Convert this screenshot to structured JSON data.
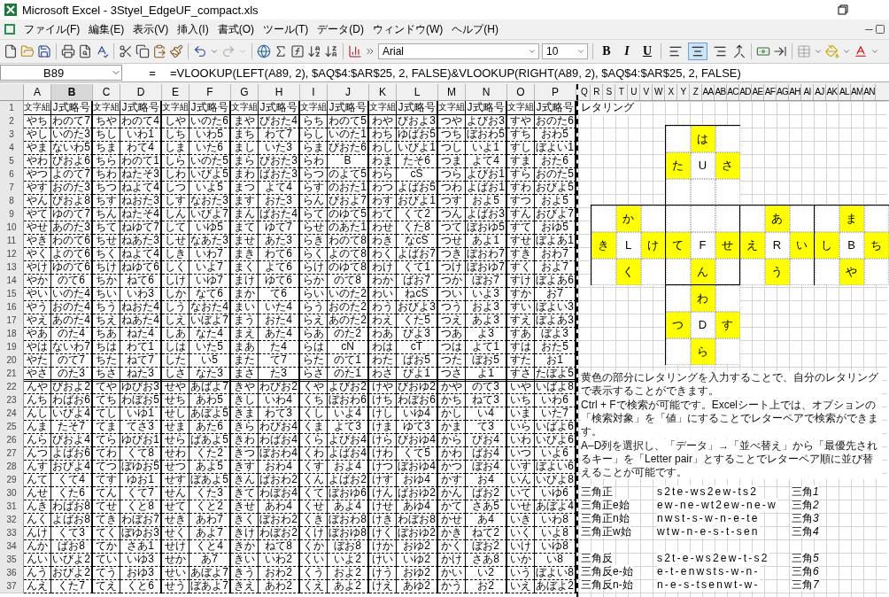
{
  "window": {
    "title": "Microsoft Excel - 3Styel_EdgeUF_compact.xls"
  },
  "menu": [
    "ファイル(F)",
    "編集(E)",
    "表示(V)",
    "挿入(I)",
    "書式(O)",
    "ツール(T)",
    "データ(D)",
    "ウィンドウ(W)",
    "ヘルプ(H)"
  ],
  "toolbar": {
    "font_name": "Arial",
    "font_size": "10",
    "style_buttons": [
      "B",
      "I",
      "U"
    ],
    "alignment": [
      {
        "selected": false
      },
      {
        "selected": true
      },
      {
        "selected": false
      }
    ]
  },
  "formula_bar": {
    "name_box": "B89",
    "equals": "=",
    "formula": "=VLOOKUP(LEFT(A89, 2), $AQ$4:$AR$25, 2, FALSE)&VLOOKUP(RIGHT(A89, 2), $AQ$4:$AR$25, 2, FALSE)"
  },
  "sheet": {
    "columns": [
      {
        "label": "A",
        "selected": false
      },
      {
        "label": "B",
        "selected": true
      },
      {
        "label": "C",
        "selected": false
      },
      {
        "label": "D",
        "selected": false
      },
      {
        "label": "E",
        "selected": false
      },
      {
        "label": "F",
        "selected": false
      },
      {
        "label": "G",
        "selected": false
      },
      {
        "label": "H",
        "selected": false
      },
      {
        "label": "I",
        "selected": false
      },
      {
        "label": "J",
        "selected": false
      },
      {
        "label": "K",
        "selected": false
      },
      {
        "label": "L",
        "selected": false
      },
      {
        "label": "M",
        "selected": false
      },
      {
        "label": "N",
        "selected": false
      },
      {
        "label": "O",
        "selected": false
      },
      {
        "label": "P",
        "selected": false
      }
    ],
    "panel_columns": [
      "Q",
      "R",
      "S",
      "T",
      "U",
      "V",
      "W",
      "X",
      "Y",
      "Z",
      "AA",
      "AB",
      "AC",
      "AD",
      "AE",
      "AF",
      "AG",
      "AH",
      "AI",
      "AJ",
      "AK",
      "AL",
      "AM",
      "AN"
    ],
    "header_row": {
      "number": "1",
      "cells": [
        "文字組",
        "J式略号",
        "文字組",
        "J式略号",
        "文字組",
        "J式略号",
        "文字組",
        "J式略号",
        "文字組",
        "J式略号",
        "文字組",
        "J式略号",
        "文字組",
        "J式略号",
        "文字組",
        "J式略号"
      ]
    },
    "blocks": [
      {
        "rows": [
          {
            "number": "2",
            "cells": [
              "やち",
              "わのて7",
              "ちや",
              "わのて4",
              "しや",
              "いのた6",
              "まや",
              "びおた4",
              "らち",
              "わのて5",
              "わや",
              "びおよ3",
              "つや",
              "よびお3",
              "すや",
              "おのた6"
            ]
          },
          {
            "number": "3",
            "cells": [
              "やし",
              "いのた3",
              "ちし",
              "いわ1",
              "しち",
              "いわ5",
              "まち",
              "わて7",
              "らし",
              "いのた1",
              "わち",
              "ゆばお5",
              "つち",
              "ぼおわ5",
              "すち",
              "おわ5"
            ]
          },
          {
            "number": "4",
            "cells": [
              "やま",
              "ないわ5",
              "ちま",
              "わて4",
              "しま",
              "いた6",
              "まし",
              "いた3",
              "らま",
              "びおた6",
              "わし",
              "いびよ1",
              "つし",
              "いよ1",
              "すし",
              "ぼよい1"
            ]
          },
          {
            "number": "5",
            "cells": [
              "やわ",
              "びおよ6",
              "ちら",
              "わのて1",
              "しら",
              "いのた5",
              "まら",
              "びおた3",
              "らわ",
              "B",
              "わま",
              "たそ6",
              "つま",
              "よて4",
              "すま",
              "おた6"
            ]
          },
          {
            "number": "6",
            "cells": [
              "やつ",
              "よのて7",
              "ちわ",
              "ねたそ3",
              "しわ",
              "いびよ5",
              "まわ",
              "ばおた3",
              "らつ",
              "のよて5",
              "わら",
              "cS",
              "つら",
              "よびお1",
              "すら",
              "おのた5"
            ]
          },
          {
            "number": "7",
            "cells": [
              "やす",
              "おのた3",
              "ちつ",
              "ねよて4",
              "しつ",
              "いよ5",
              "まつ",
              "よて4",
              "らす",
              "のおた1",
              "わつ",
              "よばお5",
              "つわ",
              "よばお1",
              "すわ",
              "おびよ5"
            ]
          },
          {
            "number": "8",
            "cells": [
              "やん",
              "びおよ8",
              "ちす",
              "ねおた3",
              "しす",
              "なおた3",
              "ます",
              "おた3",
              "らん",
              "びおよ7",
              "わす",
              "おびよ1",
              "つす",
              "およ5",
              "すつ",
              "およ5"
            ]
          },
          {
            "number": "9",
            "cells": [
              "やて",
              "ゆのて7",
              "ちん",
              "ねたそ4",
              "しん",
              "いびよ7",
              "まん",
              "ばおた4",
              "らて",
              "のゆて5",
              "わて",
              "くて2",
              "つん",
              "よばお3",
              "すん",
              "おびよ7"
            ]
          },
          {
            "number": "10",
            "cells": [
              "やせ",
              "あのた3",
              "ちて",
              "ねゆて7",
              "して",
              "いゆ5",
              "まて",
              "ゆて7",
              "らせ",
              "のあた1",
              "わせ",
              "くた8",
              "つて",
              "ぼおゆ5",
              "すて",
              "おゆ5"
            ]
          },
          {
            "number": "11",
            "cells": [
              "やき",
              "わのて6",
              "ちせ",
              "ねあた3",
              "しせ",
              "なあた3",
              "ませ",
              "あた3",
              "らき",
              "わのて8",
              "わき",
              "なcS",
              "つせ",
              "あよ1",
              "すせ",
              "ぼよあ1"
            ]
          },
          {
            "number": "12",
            "cells": [
              "やく",
              "よのて6",
              "ちく",
              "ねよて4",
              "しき",
              "いわ7",
              "まき",
              "わて6",
              "らく",
              "よのて8",
              "わく",
              "よばお7",
              "つき",
              "ぼおわ7",
              "すき",
              "おわ7"
            ]
          },
          {
            "number": "13",
            "cells": [
              "やけ",
              "ゆのて6",
              "ちけ",
              "ねゆて6",
              "しく",
              "いよ7",
              "まく",
              "よて6",
              "らけ",
              "のゆて8",
              "わけ",
              "くて1",
              "つけ",
              "ぼおゆ7",
              "すく",
              "およ7"
            ]
          },
          {
            "number": "14",
            "cells": [
              "やか",
              "のて6",
              "ちか",
              "ねて6",
              "しけ",
              "いゆ7",
              "まけ",
              "ゆて6",
              "らか",
              "のて8",
              "わか",
              "ばお7",
              "つか",
              "ぼお7",
              "すけ",
              "ぼよあ6"
            ]
          },
          {
            "number": "15",
            "cells": [
              "やい",
              "いのた4",
              "ちい",
              "いわ3",
              "しか",
              "なて6",
              "まか",
              "て6",
              "らい",
              "いのた2",
              "わい",
              "ねcS",
              "つい",
              "いよ3",
              "すか",
              "お7"
            ]
          },
          {
            "number": "16",
            "cells": [
              "やう",
              "おのた4",
              "ちう",
              "ねおた4",
              "しう",
              "なおた4",
              "まい",
              "いた4",
              "らう",
              "おのた2",
              "わう",
              "おびよ3",
              "つう",
              "およ3",
              "すい",
              "ぼよい3"
            ]
          },
          {
            "number": "17",
            "cells": [
              "やえ",
              "あのた4",
              "ちえ",
              "ねあた4",
              "しえ",
              "いぼよ7",
              "まう",
              "おた4",
              "らえ",
              "あのた2",
              "わえ",
              "くた5",
              "つえ",
              "あよ3",
              "すえ",
              "ぼよあ3"
            ]
          },
          {
            "number": "18",
            "cells": [
              "やあ",
              "のた4",
              "ちあ",
              "ねた4",
              "しあ",
              "なた4",
              "まえ",
              "あた4",
              "らあ",
              "のた2",
              "わあ",
              "びよ3",
              "つあ",
              "よ3",
              "すあ",
              "ぼよ3"
            ]
          },
          {
            "number": "19",
            "cells": [
              "やは",
              "ないわ7",
              "ちは",
              "わて1",
              "しは",
              "いた5",
              "まあ",
              "た4",
              "らは",
              "cN",
              "わは",
              "cT",
              "つは",
              "よて1",
              "すは",
              "おた5"
            ]
          },
          {
            "number": "20",
            "cells": [
              "やた",
              "のて7",
              "ちた",
              "ねて7",
              "した",
              "い5",
              "また",
              "て7",
              "らた",
              "のて1",
              "わた",
              "ばお5",
              "つた",
              "ぼお5",
              "すた",
              "お1"
            ]
          },
          {
            "number": "21",
            "cells": [
              "やさ",
              "のた3",
              "ちさ",
              "ねた3",
              "しさ",
              "なた3",
              "まさ",
              "た3",
              "らさ",
              "のた1",
              "わさ",
              "びよ1",
              "つさ",
              "よ1",
              "すさ",
              "たぼよ5"
            ]
          }
        ]
      },
      {
        "rows": [
          {
            "number": "22",
            "cells": [
              "んや",
              "びおよ2",
              "てや",
              "ゆびお3",
              "せや",
              "あばよ7",
              "きや",
              "わびお2",
              "くや",
              "よびお2",
              "けや",
              "びおゆ2",
              "かや",
              "のて3",
              "いや",
              "いばよ8"
            ]
          },
          {
            "number": "23",
            "cells": [
              "んち",
              "わばお6",
              "てち",
              "わぼお5",
              "せち",
              "あわ5",
              "きし",
              "いわ4",
              "くち",
              "ぼおわ6",
              "けち",
              "わぼお6",
              "かち",
              "ねて3",
              "いち",
              "いわ6"
            ]
          },
          {
            "number": "24",
            "cells": [
              "んし",
              "いびよ4",
              "てし",
              "いゆ1",
              "せし",
              "あぼよ5",
              "きま",
              "わて3",
              "くし",
              "いよ4",
              "けし",
              "いゆ4",
              "かし",
              "い4",
              "いま",
              "いた7"
            ]
          },
          {
            "number": "25",
            "cells": [
              "んま",
              "たそ7",
              "てま",
              "てさ3",
              "せま",
              "あた6",
              "きら",
              "わびお4",
              "くま",
              "よて3",
              "けま",
              "ゆて3",
              "かま",
              "て3",
              "いら",
              "いばよ6"
            ]
          },
          {
            "number": "26",
            "cells": [
              "んら",
              "びおよ4",
              "てら",
              "ゆびお1",
              "せら",
              "ばあよ5",
              "きわ",
              "わばお4",
              "くら",
              "よびお4",
              "けら",
              "びおゆ4",
              "から",
              "びお4",
              "いわ",
              "いびよ6"
            ]
          },
          {
            "number": "27",
            "cells": [
              "んつ",
              "よばお6",
              "てわ",
              "くて8",
              "せわ",
              "くた2",
              "きつ",
              "ぼおわ4",
              "くわ",
              "よばお4",
              "けわ",
              "くて5",
              "かわ",
              "ばお4",
              "いつ",
              "いよ6"
            ]
          },
          {
            "number": "28",
            "cells": [
              "んす",
              "おびよ4",
              "てつ",
              "ぼゆお5",
              "せつ",
              "あよ5",
              "きす",
              "おわ4",
              "くす",
              "およ4",
              "けつ",
              "ぼおゆ4",
              "かつ",
              "ぼお4",
              "いす",
              "ぼよい6"
            ]
          },
          {
            "number": "29",
            "cells": [
              "んて",
              "くて4",
              "てす",
              "ゆお1",
              "せす",
              "ぼあよ5",
              "きん",
              "ばおわ2",
              "くん",
              "よばお2",
              "けす",
              "おゆ4",
              "かす",
              "お4",
              "いん",
              "いびよ8"
            ]
          },
          {
            "number": "30",
            "cells": [
              "んせ",
              "くた6",
              "てん",
              "くて7",
              "せん",
              "くた3",
              "きて",
              "わぼお4",
              "くて",
              "ぼおゆ6",
              "けん",
              "ばおゆ2",
              "かん",
              "ばお2",
              "いて",
              "いゆ6"
            ]
          },
          {
            "number": "31",
            "cells": [
              "んき",
              "わばお8",
              "てせ",
              "くと8",
              "せて",
              "くと2",
              "きせ",
              "あわ4",
              "くせ",
              "あよ4",
              "けせ",
              "あゆ4",
              "かて",
              "さあ5",
              "いせ",
              "あぼよ4"
            ]
          },
          {
            "number": "32",
            "cells": [
              "んく",
              "よばお8",
              "てき",
              "わぼお7",
              "せき",
              "あわ7",
              "きく",
              "ぼおわ2",
              "くき",
              "ぼおわ8",
              "けき",
              "わぼお8",
              "かせ",
              "あ4",
              "いき",
              "いわ8"
            ]
          },
          {
            "number": "33",
            "cells": [
              "んけ",
              "くて3",
              "てく",
              "ぼゆお3",
              "せく",
              "あよ7",
              "きけ",
              "わぼお2",
              "くけ",
              "ぼおゆ8",
              "けく",
              "ぼおゆ2",
              "かき",
              "ねて2",
              "いく",
              "いよ8"
            ]
          },
          {
            "number": "34",
            "cells": [
              "んか",
              "ばお8",
              "てか",
              "さあ1",
              "せけ",
              "くと4",
              "きか",
              "ねて8",
              "くか",
              "ぼお8",
              "けか",
              "おゆ2",
              "かく",
              "ぼお2",
              "いけ",
              "いゆ8"
            ]
          },
          {
            "number": "35",
            "cells": [
              "んい",
              "いびよ2",
              "てい",
              "いゆ3",
              "せか",
              "あ7",
              "きい",
              "いわ2",
              "くい",
              "いよ2",
              "けい",
              "いゆ2",
              "かけ",
              "さあ8",
              "いか",
              "い8"
            ]
          },
          {
            "number": "36",
            "cells": [
              "んう",
              "おびよ2",
              "てう",
              "おゆ3",
              "せい",
              "あぼよ7",
              "きう",
              "おわ2",
              "くう",
              "およ2",
              "けう",
              "おゆ2",
              "かい",
              "い2",
              "いう",
              "ぼよい8"
            ]
          },
          {
            "number": "37",
            "cells": [
              "んえ",
              "くた7",
              "てえ",
              "くと6",
              "せう",
              "ぼあよ7",
              "きえ",
              "あわ2",
              "くえ",
              "あよ2",
              "けえ",
              "あゆ2",
              "かう",
              "お2",
              "いえ",
              "あぼよ2"
            ]
          }
        ]
      }
    ]
  },
  "panel": {
    "title": "レタリング",
    "cube_rows": [
      [
        {
          "center": "U",
          "top": "は",
          "left": "た",
          "right": "さ"
        }
      ],
      [
        {
          "center": "L",
          "top": "か",
          "left": "き",
          "right": "け",
          "bottom": "く"
        },
        {
          "center": "F",
          "left": "て",
          "right": "せ",
          "bottom": "ん"
        },
        {
          "center": "R",
          "top": "あ",
          "left": "え",
          "right": "い",
          "bottom": "う"
        },
        {
          "center": "B",
          "top": "ま",
          "left": "し",
          "right": "ち",
          "bottom": "や"
        }
      ],
      [
        {
          "center": "D",
          "top": "わ",
          "left": "つ",
          "right": "す",
          "bottom": "ら"
        }
      ]
    ],
    "notes": [
      "黄色の部分にレタリングを入力することで、自分のレタリングで表示することができます。",
      "Ctrl + Fで検索が可能です。Excelシート上では、オプションの「検索対象」を「値」にすることでレターペアで検索ができます。",
      "A–D列を選択し、「データ」→「並べ替え」から「最優先されるキー」を「Letter pair」とすることでレターペア順に並び替えることが可能です。"
    ],
    "triangle_groups": [
      [
        {
          "name": "三角正",
          "sequence": "s2te-ws2ew-ts2",
          "short": "三角",
          "index": "1"
        },
        {
          "name": "三角正e始",
          "sequence": "ew-ne-wt2ew-ne-w",
          "short": "三角",
          "index": "2"
        },
        {
          "name": "三角正n始",
          "sequence": "nwst-s-w-n-e-te",
          "short": "三角",
          "index": "3"
        },
        {
          "name": "三角正w始",
          "sequence": "wtw-n-e-s-t-sen",
          "short": "三角",
          "index": "4"
        }
      ],
      [
        {
          "name": "三角反",
          "sequence": "s2t-e-ws2ew-t-s2",
          "short": "三角",
          "index": "5"
        },
        {
          "name": "三角反e-始",
          "sequence": "e-t-enwsts-w-n-",
          "short": "三角",
          "index": "6"
        },
        {
          "name": "三角反n-始",
          "sequence": "n-e-s-tsenwt-w-",
          "short": "三角",
          "index": "7"
        }
      ]
    ]
  }
}
